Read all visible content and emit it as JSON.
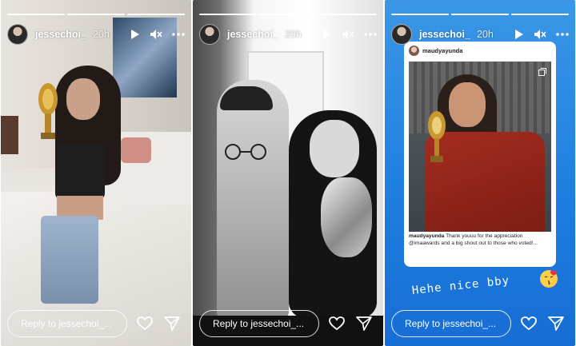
{
  "colors": {
    "story3_background": "#2b8ae3",
    "card_jacket": "#a52c1f",
    "trophy_gold": "#c9972e"
  },
  "stories": [
    {
      "username": "jessechoi_",
      "time": "20h",
      "reply_placeholder": "Reply to jessechoi_...",
      "progress": [
        1.0,
        1.0,
        0.0
      ]
    },
    {
      "username": "jessechoi_",
      "time": "20h",
      "reply_placeholder": "Reply to jessechoi_...",
      "progress": [
        1.0,
        1.0,
        1.0
      ]
    },
    {
      "username": "jessechoi_",
      "time": "20h",
      "reply_placeholder": "Reply to jessechoi_...",
      "progress": [
        1.0,
        1.0,
        1.0
      ],
      "repost": {
        "username": "maudyayunda",
        "caption_user": "maudyayunda",
        "caption_text": "Thank youuu for the appreciation @imaawards and a big shout out to those who voted!..."
      },
      "overlay_text": "Hehe nice bby"
    }
  ],
  "icons": {
    "play": "play-icon",
    "mute": "mute-icon",
    "more": "more-icon",
    "like": "heart-icon",
    "share": "send-icon"
  }
}
